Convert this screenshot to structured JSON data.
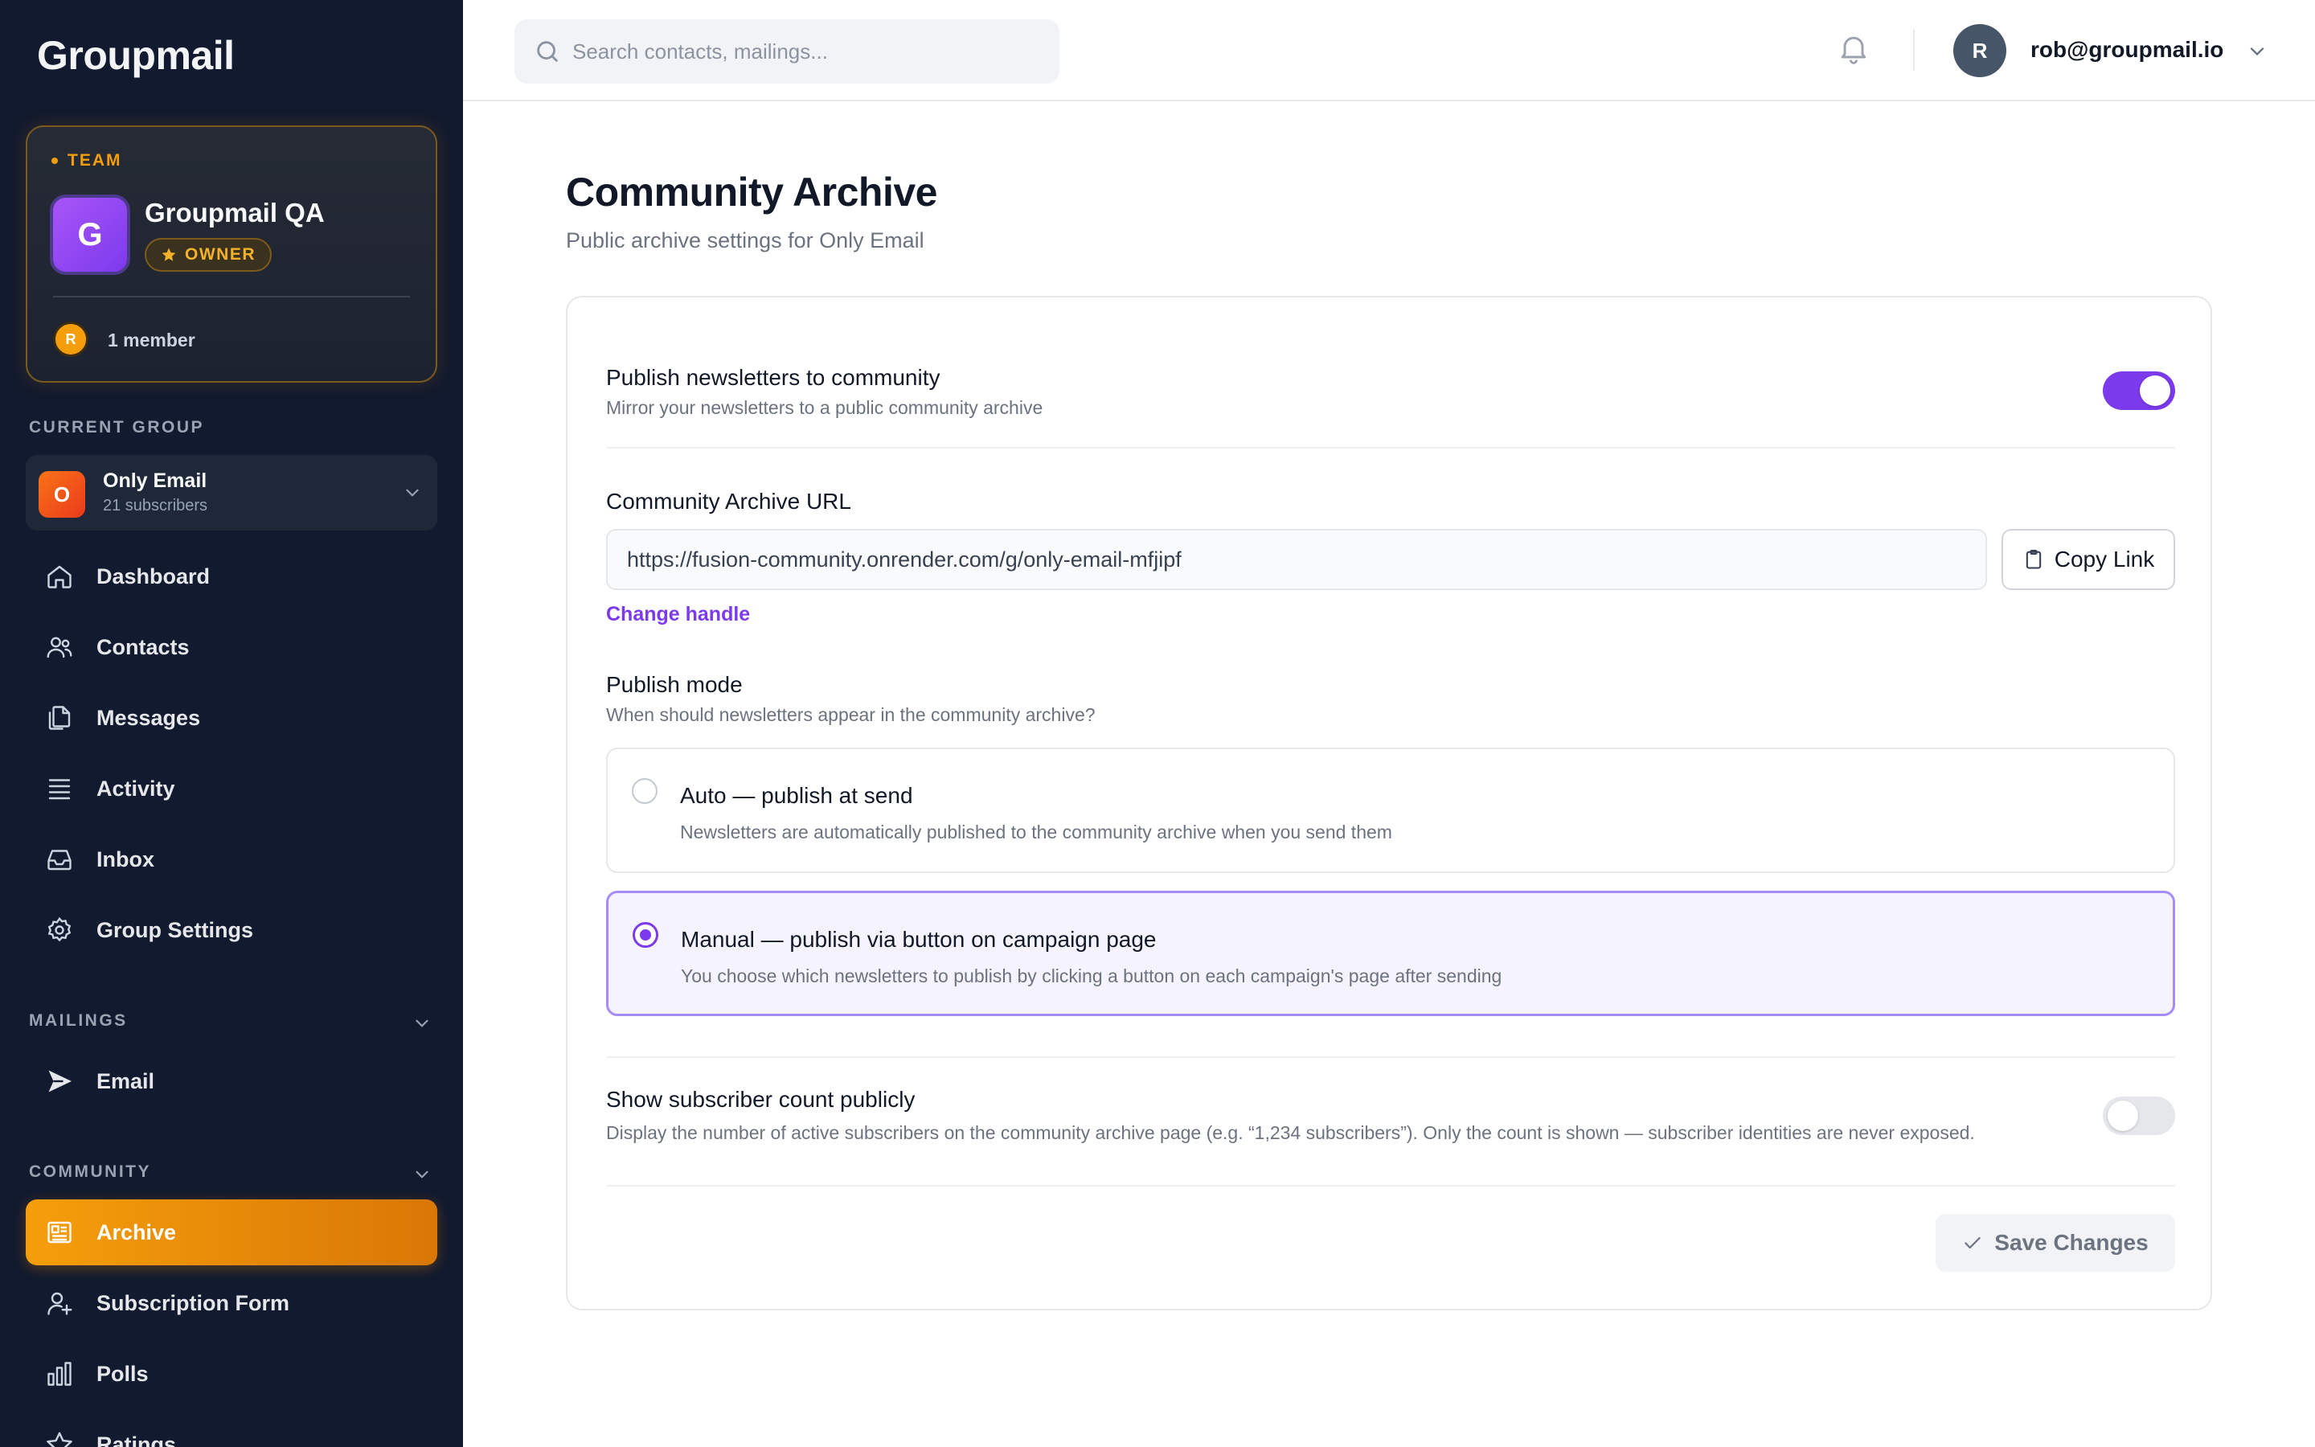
{
  "app": {
    "logo": "Groupmail"
  },
  "team": {
    "tag": "TEAM",
    "avatar_letter": "G",
    "name": "Groupmail QA",
    "role": "OWNER",
    "member_avatar": "R",
    "member_count": "1 member"
  },
  "current_group": {
    "section_label": "CURRENT GROUP",
    "avatar_letter": "O",
    "name": "Only Email",
    "subscribers": "21 subscribers"
  },
  "nav": {
    "dashboard": "Dashboard",
    "contacts": "Contacts",
    "messages": "Messages",
    "activity": "Activity",
    "inbox": "Inbox",
    "group_settings": "Group Settings"
  },
  "mailings": {
    "section_label": "MAILINGS",
    "email": "Email"
  },
  "community": {
    "section_label": "COMMUNITY",
    "archive": "Archive",
    "subscription_form": "Subscription Form",
    "polls": "Polls",
    "ratings": "Ratings"
  },
  "topbar": {
    "search_placeholder": "Search contacts, mailings...",
    "user_avatar": "R",
    "user_email": "rob@groupmail.io"
  },
  "page": {
    "title": "Community Archive",
    "subtitle": "Public archive settings for Only Email"
  },
  "settings": {
    "publish": {
      "title": "Publish newsletters to community",
      "desc": "Mirror your newsletters to a public community archive",
      "enabled": true
    },
    "url": {
      "label": "Community Archive URL",
      "value": "https://fusion-community.onrender.com/g/only-email-mfjipf",
      "copy_label": "Copy Link",
      "change_handle": "Change handle"
    },
    "mode": {
      "title": "Publish mode",
      "desc": "When should newsletters appear in the community archive?",
      "options": [
        {
          "title": "Auto — publish at send",
          "desc": "Newsletters are automatically published to the community archive when you send them",
          "selected": false
        },
        {
          "title": "Manual — publish via button on campaign page",
          "desc": "You choose which newsletters to publish by clicking a button on each campaign's page after sending",
          "selected": true
        }
      ]
    },
    "subscriber_count": {
      "title": "Show subscriber count publicly",
      "desc": "Display the number of active subscribers on the community archive page (e.g. “1,234 subscribers”). Only the count is shown — subscriber identities are never exposed.",
      "enabled": false
    },
    "save_label": "Save Changes"
  },
  "colors": {
    "accent": "#7c3aed",
    "active_nav": "#f59e0b",
    "sidebar_bg": "#111a2e"
  }
}
